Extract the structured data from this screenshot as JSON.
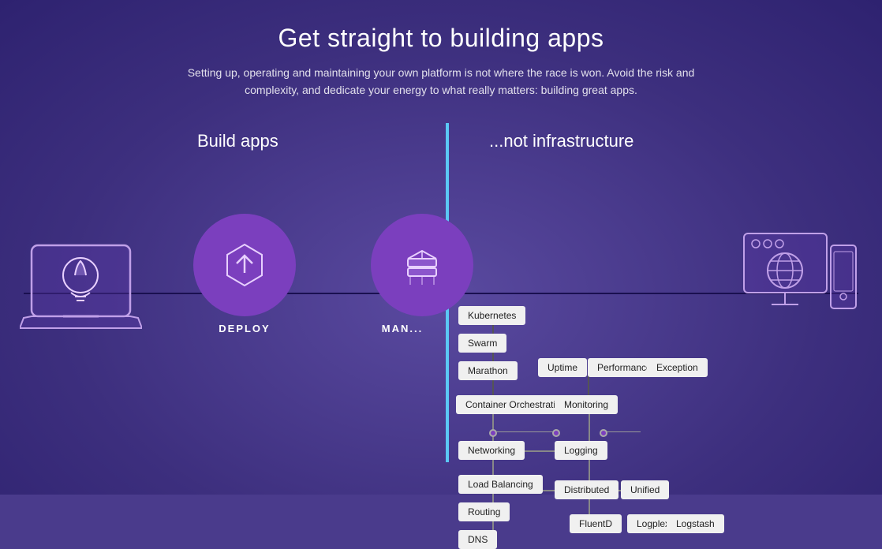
{
  "page": {
    "headline": "Get straight to building apps",
    "subtext": "Setting up, operating and maintaining your own platform is not where the race is won. Avoid the risk and complexity, and dedicate your energy to what really matters: building great apps.",
    "left_section_label": "Build apps",
    "right_section_label": "...not infrastructure",
    "deploy_label": "DEPLOY",
    "manage_label": "MAN...",
    "boxes": {
      "container_orchestration": "Container Orchestration",
      "kubernetes": "Kubernetes",
      "swarm": "Swarm",
      "marathon": "Marathon",
      "monitoring": "Monitoring",
      "uptime": "Uptime",
      "performance": "Performance",
      "exception": "Exception",
      "networking": "Networking",
      "logging": "Logging",
      "load_balancing": "Load Balancing",
      "distributed": "Distributed",
      "unified": "Unified",
      "routing": "Routing",
      "dns": "DNS",
      "fluentd": "FluentD",
      "logplex": "Logplex",
      "logstash": "Logstash"
    }
  }
}
